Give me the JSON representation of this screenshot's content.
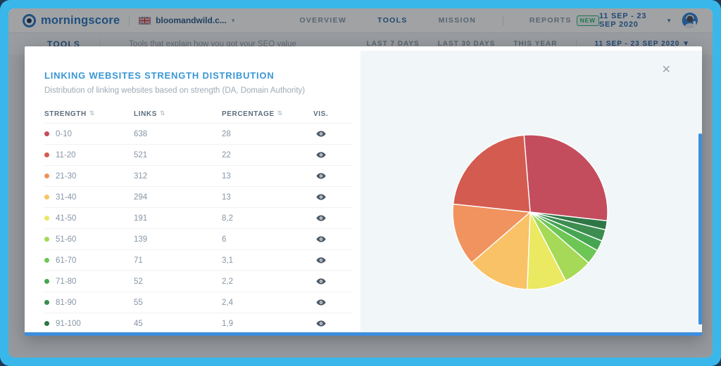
{
  "navbar": {
    "logo_text": "morningscore",
    "site": {
      "domain": "bloomandwild.c...",
      "flag": "uk-flag"
    },
    "items": [
      {
        "label": "OVERVIEW",
        "active": false
      },
      {
        "label": "TOOLS",
        "active": true
      },
      {
        "label": "MISSION",
        "active": false
      }
    ],
    "reports_label": "REPORTS",
    "reports_badge": "NEW",
    "date_range": "11 SEP - 23 SEP 2020",
    "caret": "▾"
  },
  "subheader": {
    "title": "TOOLS",
    "description": "Tools that explain how you got your SEO value",
    "filters": [
      "LAST 7 DAYS",
      "LAST 30 DAYS",
      "THIS YEAR"
    ],
    "date_range": "11 SEP - 23 SEP 2020 ▼"
  },
  "modal": {
    "title": "LINKING WEBSITES STRENGTH DISTRIBUTION",
    "subtitle": "Distribution of linking websites based on strength (DA, Domain Authority)",
    "close_glyph": "✕",
    "columns": [
      {
        "label": "STRENGTH",
        "sortable": true
      },
      {
        "label": "LINKS",
        "sortable": true
      },
      {
        "label": "PERCENTAGE",
        "sortable": true
      },
      {
        "label": "VIS.",
        "sortable": false
      }
    ],
    "sort_glyph": "⇅",
    "rows": [
      {
        "strength": "0-10",
        "links": "638",
        "percentage": "28",
        "color": "#c44d5d"
      },
      {
        "strength": "11-20",
        "links": "521",
        "percentage": "22",
        "color": "#d45b50"
      },
      {
        "strength": "21-30",
        "links": "312",
        "percentage": "13",
        "color": "#f0935e"
      },
      {
        "strength": "31-40",
        "links": "294",
        "percentage": "13",
        "color": "#f9c266"
      },
      {
        "strength": "41-50",
        "links": "191",
        "percentage": "8,2",
        "color": "#ebe862"
      },
      {
        "strength": "51-60",
        "links": "139",
        "percentage": "6",
        "color": "#a6d957"
      },
      {
        "strength": "61-70",
        "links": "71",
        "percentage": "3,1",
        "color": "#6ec655"
      },
      {
        "strength": "71-80",
        "links": "52",
        "percentage": "2,2",
        "color": "#46a553"
      },
      {
        "strength": "81-90",
        "links": "55",
        "percentage": "2,4",
        "color": "#3c8d4f"
      },
      {
        "strength": "91-100",
        "links": "45",
        "percentage": "1,9",
        "color": "#2f7647"
      }
    ]
  },
  "chart_data": {
    "type": "pie",
    "title": "Linking websites strength distribution",
    "categories": [
      "0-10",
      "11-20",
      "21-30",
      "31-40",
      "41-50",
      "51-60",
      "61-70",
      "71-80",
      "81-90",
      "91-100"
    ],
    "values": [
      28,
      22,
      13,
      13,
      8.2,
      6,
      3.1,
      2.2,
      2.4,
      1.9
    ],
    "links": [
      638,
      521,
      312,
      294,
      191,
      139,
      71,
      52,
      55,
      45
    ],
    "colors": [
      "#c44d5d",
      "#d45b50",
      "#f0935e",
      "#f9c266",
      "#ebe862",
      "#a6d957",
      "#6ec655",
      "#46a553",
      "#3c8d4f",
      "#2f7647"
    ],
    "legend": "none",
    "start_angle_deg": -4.6,
    "slice_border_color": "#ffffff"
  },
  "colors": {
    "frame_blue": "#3ab7ea",
    "accent_blue": "#3f8edd",
    "title_blue": "#3a97d6",
    "panel_bg": "#f1f6f9"
  }
}
